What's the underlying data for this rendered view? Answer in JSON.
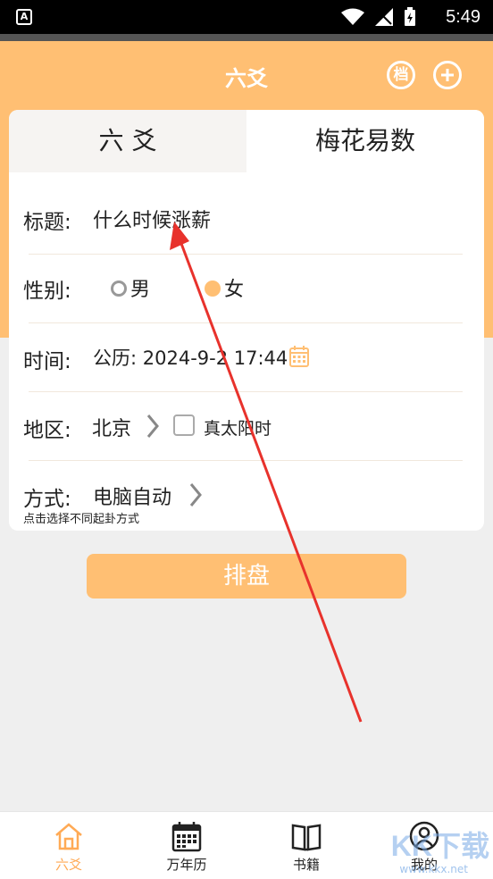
{
  "status_bar": {
    "time": "5:49"
  },
  "header": {
    "title": "六爻",
    "archive_button": "档"
  },
  "tabs": [
    {
      "label": "六 爻",
      "active": false
    },
    {
      "label": "梅花易数",
      "active": true
    }
  ],
  "form": {
    "title_label": "标题:",
    "title_value": "什么时候涨薪",
    "gender_label": "性别:",
    "gender_options": [
      "男",
      "女"
    ],
    "gender_selected": "女",
    "time_label": "时间:",
    "time_value": "公历: 2024-9-2 17:44",
    "region_label": "地区:",
    "region_value": "北京",
    "true_solar_label": "真太阳时",
    "method_label": "方式:",
    "method_value": "电脑自动",
    "method_hint": "点击选择不同起卦方式"
  },
  "submit_label": "排盘",
  "bottom_nav": [
    {
      "label": "六爻",
      "icon": "home-icon",
      "active": true
    },
    {
      "label": "万年历",
      "icon": "calendar-icon",
      "active": false
    },
    {
      "label": "书籍",
      "icon": "book-icon",
      "active": false
    },
    {
      "label": "我的",
      "icon": "user-icon",
      "active": false
    }
  ],
  "watermark": {
    "text": "KK下载",
    "url": "www.kkx.net"
  },
  "colors": {
    "accent": "#ffbf73",
    "active_nav": "#ffaa55"
  }
}
